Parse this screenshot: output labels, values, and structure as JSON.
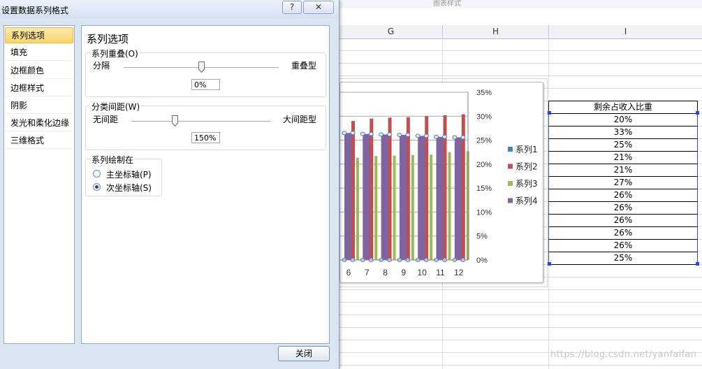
{
  "dialog": {
    "title": "设置数据系列格式",
    "help_label": "?",
    "close_label": "✕",
    "nav": [
      "系列选项",
      "填充",
      "边框颜色",
      "边框样式",
      "阴影",
      "发光和柔化边缘",
      "三维格式"
    ],
    "panel_title": "系列选项",
    "overlap": {
      "label": "系列重叠(O)",
      "left": "分隔",
      "right": "重叠型",
      "value": "0%"
    },
    "gap": {
      "label": "分类间距(W)",
      "left": "无间距",
      "right": "大间距型",
      "value": "150%"
    },
    "plot_on": {
      "label": "系列绘制在",
      "primary": "主坐标轴(P)",
      "secondary": "次坐标轴(S)",
      "selected": "secondary"
    },
    "close_button": "关闭"
  },
  "ribbon": {
    "group_label": "图表样式"
  },
  "sheet": {
    "columns": [
      "G",
      "H",
      "I"
    ],
    "table": {
      "header": "剩余占收入比重",
      "values": [
        "20%",
        "33%",
        "25%",
        "21%",
        "21%",
        "27%",
        "26%",
        "26%",
        "26%",
        "26%",
        "26%",
        "25%"
      ]
    }
  },
  "watermark": "https://blog.csdn.net/yanfaifan",
  "chart_data": {
    "type": "bar",
    "categories": [
      "6",
      "7",
      "8",
      "9",
      "10",
      "11",
      "12"
    ],
    "y2_ticks": [
      "35%",
      "30%",
      "25%",
      "20%",
      "15%",
      "10%",
      "5%",
      "0%"
    ],
    "ylim": [
      0,
      0.35
    ],
    "series": [
      {
        "name": "系列1",
        "color": "#4f81bd",
        "values": [
          0,
          0,
          0,
          0,
          0,
          0,
          0
        ]
      },
      {
        "name": "系列2",
        "color": "#c0504d",
        "values": [
          0.29,
          0.295,
          0.297,
          0.298,
          0.3,
          0.302,
          0.304
        ]
      },
      {
        "name": "系列3",
        "color": "#9bbb59",
        "values": [
          0.213,
          0.217,
          0.218,
          0.219,
          0.22,
          0.225,
          0.227
        ]
      },
      {
        "name": "系列4",
        "color": "#8064a2",
        "values": [
          0.265,
          0.263,
          0.262,
          0.261,
          0.259,
          0.257,
          0.256
        ]
      }
    ]
  }
}
